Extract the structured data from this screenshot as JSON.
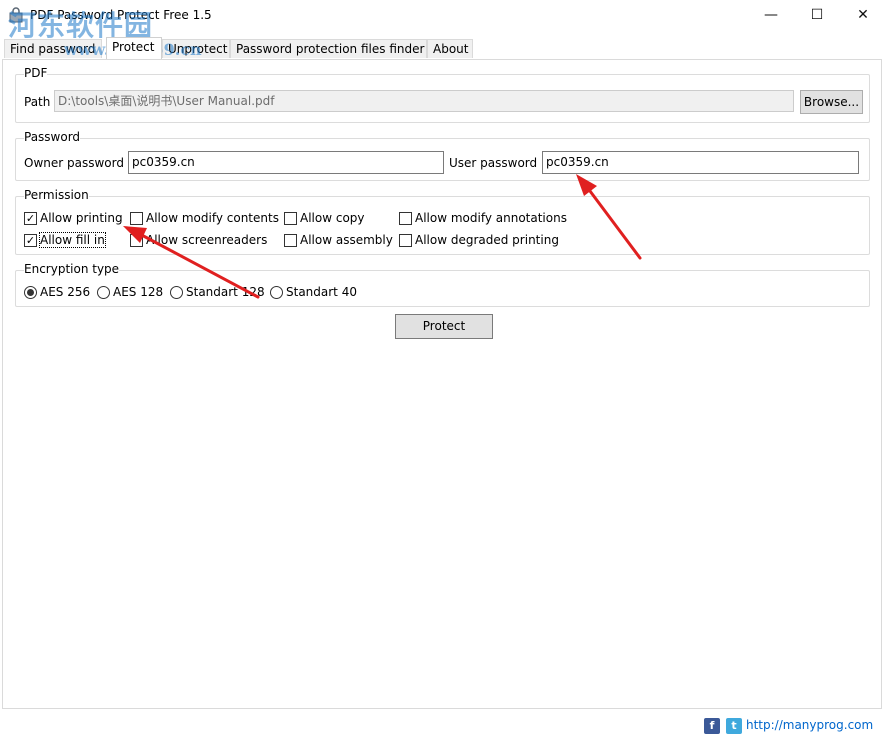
{
  "window": {
    "title": "PDF Password Protect Free 1.5",
    "minimize_glyph": "—",
    "maximize_glyph": "☐",
    "close_glyph": "✕"
  },
  "watermark": {
    "text_cn": "河东软件园",
    "text_url": "www.pc0359.cn"
  },
  "tabs": [
    {
      "label": "Find password"
    },
    {
      "label": "Protect"
    },
    {
      "label": "Unprotect"
    },
    {
      "label": "Password protection files finder"
    },
    {
      "label": "About"
    }
  ],
  "pdf_group": {
    "title": "PDF",
    "path_label": "Path",
    "path_value": "D:\\tools\\桌面\\说明书\\User Manual.pdf",
    "browse_label": "Browse..."
  },
  "password_group": {
    "title": "Password",
    "owner_label": "Owner password",
    "owner_value": "pc0359.cn",
    "user_label": "User password",
    "user_value": "pc0359.cn"
  },
  "permission_group": {
    "title": "Permission",
    "items": [
      {
        "label": "Allow printing",
        "checked": true
      },
      {
        "label": "Allow modify contents",
        "checked": false
      },
      {
        "label": "Allow copy",
        "checked": false
      },
      {
        "label": "Allow modify annotations",
        "checked": false
      },
      {
        "label": "Allow fill in",
        "checked": true
      },
      {
        "label": "Allow screenreaders",
        "checked": false
      },
      {
        "label": "Allow assembly",
        "checked": false
      },
      {
        "label": "Allow degraded printing",
        "checked": false
      }
    ]
  },
  "encryption_group": {
    "title": "Encryption type",
    "options": [
      {
        "label": "AES 256",
        "selected": true
      },
      {
        "label": "AES 128",
        "selected": false
      },
      {
        "label": "Standart 128",
        "selected": false
      },
      {
        "label": "Standart 40",
        "selected": false
      }
    ]
  },
  "protect_button": {
    "label": "Protect"
  },
  "footer": {
    "facebook_glyph": "f",
    "twitter_glyph": "t",
    "link": "http://manyprog.com"
  },
  "colors": {
    "arrow": "#e02020",
    "link": "#0066cc",
    "accent": "#1e78c8"
  }
}
